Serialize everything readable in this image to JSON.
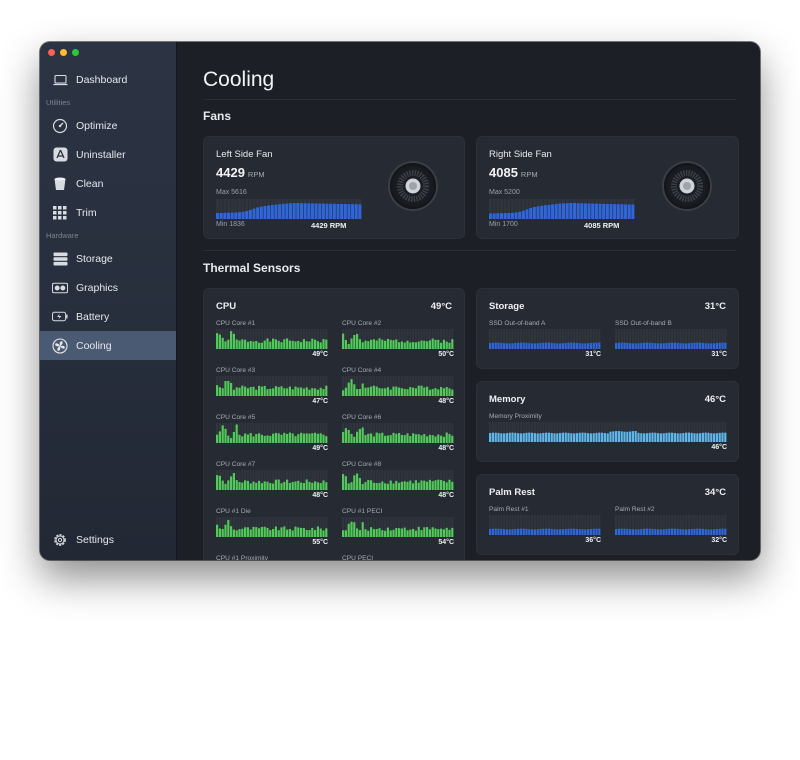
{
  "window": {
    "controls": [
      "close",
      "minimize",
      "zoom"
    ]
  },
  "sidebar": {
    "dashboard": {
      "label": "Dashboard",
      "icon": "laptop-icon"
    },
    "sections": [
      {
        "title": "Utilities",
        "items": [
          {
            "label": "Optimize",
            "icon": "gauge-icon"
          },
          {
            "label": "Uninstaller",
            "icon": "app-store-icon"
          },
          {
            "label": "Clean",
            "icon": "bucket-icon"
          },
          {
            "label": "Trim",
            "icon": "grid-icon"
          }
        ]
      },
      {
        "title": "Hardware",
        "items": [
          {
            "label": "Storage",
            "icon": "drive-icon"
          },
          {
            "label": "Graphics",
            "icon": "gpu-icon"
          },
          {
            "label": "Battery",
            "icon": "battery-icon"
          },
          {
            "label": "Cooling",
            "icon": "fan-icon",
            "active": true
          }
        ]
      }
    ],
    "settings": {
      "label": "Settings",
      "icon": "gear-icon"
    }
  },
  "main": {
    "title": "Cooling",
    "fans_title": "Fans",
    "thermal_title": "Thermal Sensors",
    "fans": [
      {
        "name": "Left Side Fan",
        "rpm": "4429",
        "unit": "RPM",
        "max": "Max 5616",
        "min": "Min 1836",
        "current": "4429 RPM",
        "history": [
          0.3,
          0.3,
          0.31,
          0.31,
          0.32,
          0.33,
          0.34,
          0.36,
          0.4,
          0.45,
          0.52,
          0.58,
          0.62,
          0.65,
          0.68,
          0.7,
          0.72,
          0.74,
          0.76,
          0.78,
          0.79,
          0.8,
          0.8,
          0.79,
          0.79,
          0.78,
          0.78,
          0.78,
          0.77,
          0.77,
          0.76,
          0.76,
          0.76,
          0.75,
          0.75,
          0.75,
          0.74,
          0.74,
          0.74,
          0.73
        ]
      },
      {
        "name": "Right Side Fan",
        "rpm": "4085",
        "unit": "RPM",
        "max": "Max 5200",
        "min": "Min 1700",
        "current": "4085 RPM",
        "history": [
          0.28,
          0.28,
          0.29,
          0.29,
          0.3,
          0.3,
          0.31,
          0.33,
          0.36,
          0.41,
          0.48,
          0.55,
          0.6,
          0.63,
          0.66,
          0.69,
          0.71,
          0.73,
          0.75,
          0.77,
          0.78,
          0.79,
          0.8,
          0.8,
          0.79,
          0.79,
          0.78,
          0.78,
          0.77,
          0.77,
          0.76,
          0.76,
          0.75,
          0.75,
          0.74,
          0.74,
          0.74,
          0.73,
          0.73,
          0.72
        ]
      }
    ],
    "groups": {
      "cpu": {
        "name": "CPU",
        "temp": "49°C",
        "color": "#52c95a",
        "sensors": [
          {
            "label": "CPU Core #1",
            "temp": "49°C",
            "seed": 1
          },
          {
            "label": "CPU Core #2",
            "temp": "50°C",
            "seed": 2
          },
          {
            "label": "CPU Core #3",
            "temp": "47°C",
            "seed": 3
          },
          {
            "label": "CPU Core #4",
            "temp": "48°C",
            "seed": 4
          },
          {
            "label": "CPU Core #5",
            "temp": "49°C",
            "seed": 5
          },
          {
            "label": "CPU Core #6",
            "temp": "48°C",
            "seed": 6
          },
          {
            "label": "CPU Core #7",
            "temp": "48°C",
            "seed": 7
          },
          {
            "label": "CPU Core #8",
            "temp": "48°C",
            "seed": 8
          },
          {
            "label": "CPU #1 Die",
            "temp": "55°C",
            "seed": 9
          },
          {
            "label": "CPU #1 PECI",
            "temp": "54°C",
            "seed": 10
          },
          {
            "label": "CPU #1 Proximity",
            "temp": "",
            "seed": 11
          },
          {
            "label": "CPU PECI",
            "temp": "",
            "seed": 12
          }
        ]
      },
      "storage": {
        "name": "Storage",
        "temp": "31°C",
        "color": "#2f66d9",
        "sensors": [
          {
            "label": "SSD Out-of-band A",
            "temp": "31°C"
          },
          {
            "label": "SSD Out-of-band B",
            "temp": "31°C"
          }
        ]
      },
      "memory": {
        "name": "Memory",
        "temp": "46°C",
        "color": "#5fb6e8",
        "sensors": [
          {
            "label": "Memory Proximity",
            "temp": "46°C"
          }
        ]
      },
      "palm": {
        "name": "Palm Rest",
        "temp": "34°C",
        "color": "#2f66d9",
        "sensors": [
          {
            "label": "Palm Rest #1",
            "temp": "36°C"
          },
          {
            "label": "Palm Rest #2",
            "temp": "32°C"
          }
        ]
      }
    }
  }
}
